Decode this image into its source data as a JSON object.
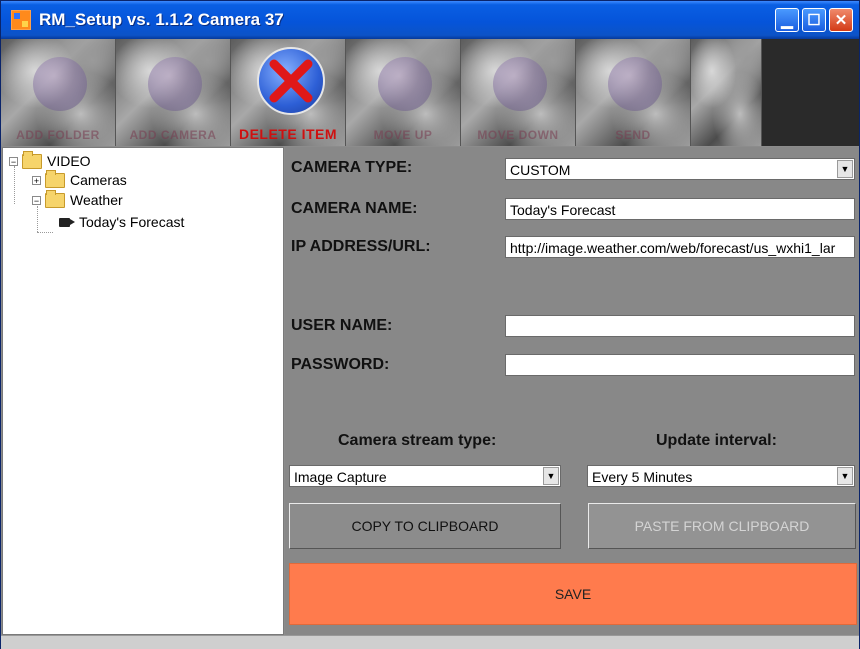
{
  "window": {
    "title": "RM_Setup vs. 1.1.2  Camera 37"
  },
  "toolbar": {
    "items": [
      {
        "label": "ADD FOLDER",
        "icon": "add-folder-icon"
      },
      {
        "label": "ADD CAMERA",
        "icon": "add-camera-icon"
      },
      {
        "label": "DELETE ITEM",
        "icon": "delete-x-icon"
      },
      {
        "label": "MOVE UP",
        "icon": "move-up-icon"
      },
      {
        "label": "MOVE DOWN",
        "icon": "move-down-icon"
      },
      {
        "label": "SEND",
        "icon": "send-icon"
      }
    ]
  },
  "tree": {
    "root": "VIDEO",
    "cameras": "Cameras",
    "weather": "Weather",
    "forecast": "Today's Forecast"
  },
  "form": {
    "camera_type_label": "CAMERA TYPE:",
    "camera_type_value": "CUSTOM",
    "camera_name_label": "CAMERA NAME:",
    "camera_name_value": "Today's Forecast",
    "ip_label": "IP ADDRESS/URL:",
    "ip_value": "http://image.weather.com/web/forecast/us_wxhi1_lar",
    "user_label": "USER NAME:",
    "user_value": "",
    "password_label": "PASSWORD:",
    "password_value": "",
    "stream_type_label": "Camera stream type:",
    "stream_type_value": "Image Capture",
    "interval_label": "Update interval:",
    "interval_value": "Every 5 Minutes",
    "copy_label": "COPY TO CLIPBOARD",
    "paste_label": "PASTE FROM CLIPBOARD",
    "save_label": "SAVE"
  },
  "colors": {
    "titlebar": "#0554da",
    "save": "#ff7b4d"
  }
}
